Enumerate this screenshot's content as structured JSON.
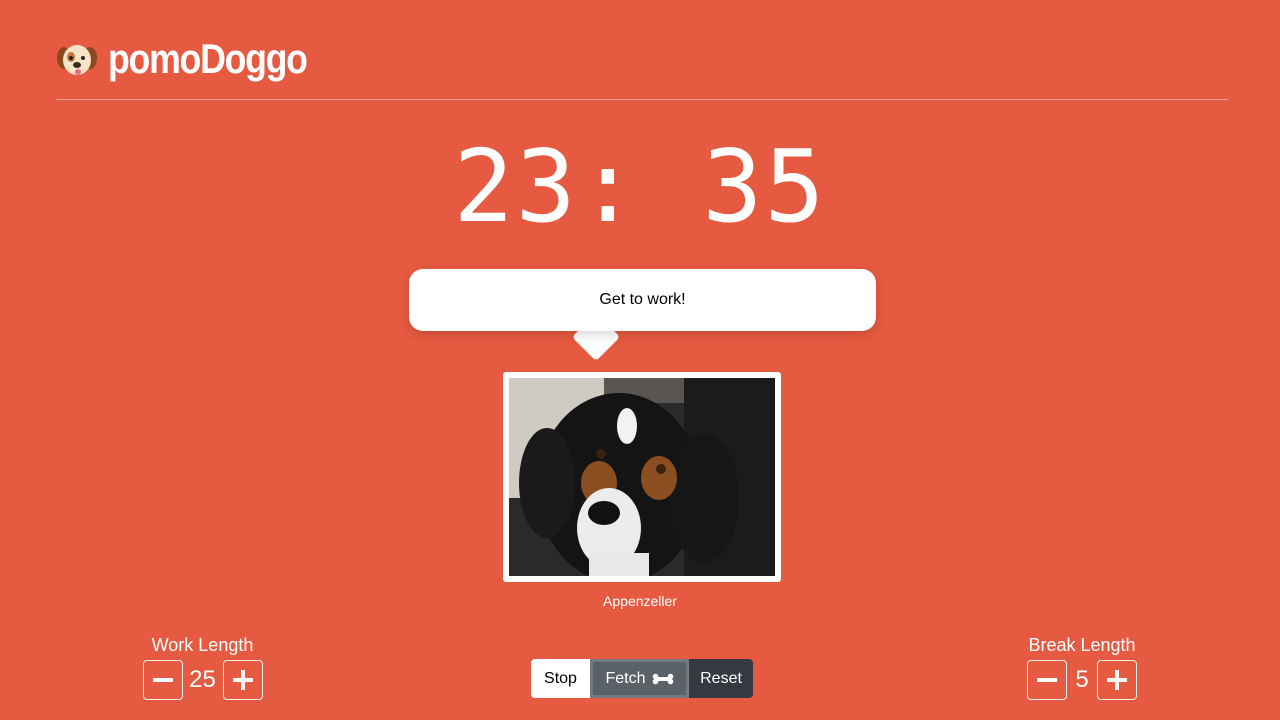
{
  "header": {
    "brand": "pomoDoggo",
    "logo_icon": "puppy-face-icon"
  },
  "timer": {
    "display": "23: 35"
  },
  "message": {
    "text": "Get to work!"
  },
  "dog": {
    "breed": "Appenzeller"
  },
  "work_length": {
    "label": "Work Length",
    "value": "25"
  },
  "break_length": {
    "label": "Break Length",
    "value": "5"
  },
  "controls": {
    "stop": "Stop",
    "fetch": "Fetch",
    "reset": "Reset",
    "fetch_icon": "bone-icon"
  },
  "colors": {
    "background": "#e55a40",
    "fetch_button": "#5a6268",
    "reset_button": "#343a40"
  }
}
